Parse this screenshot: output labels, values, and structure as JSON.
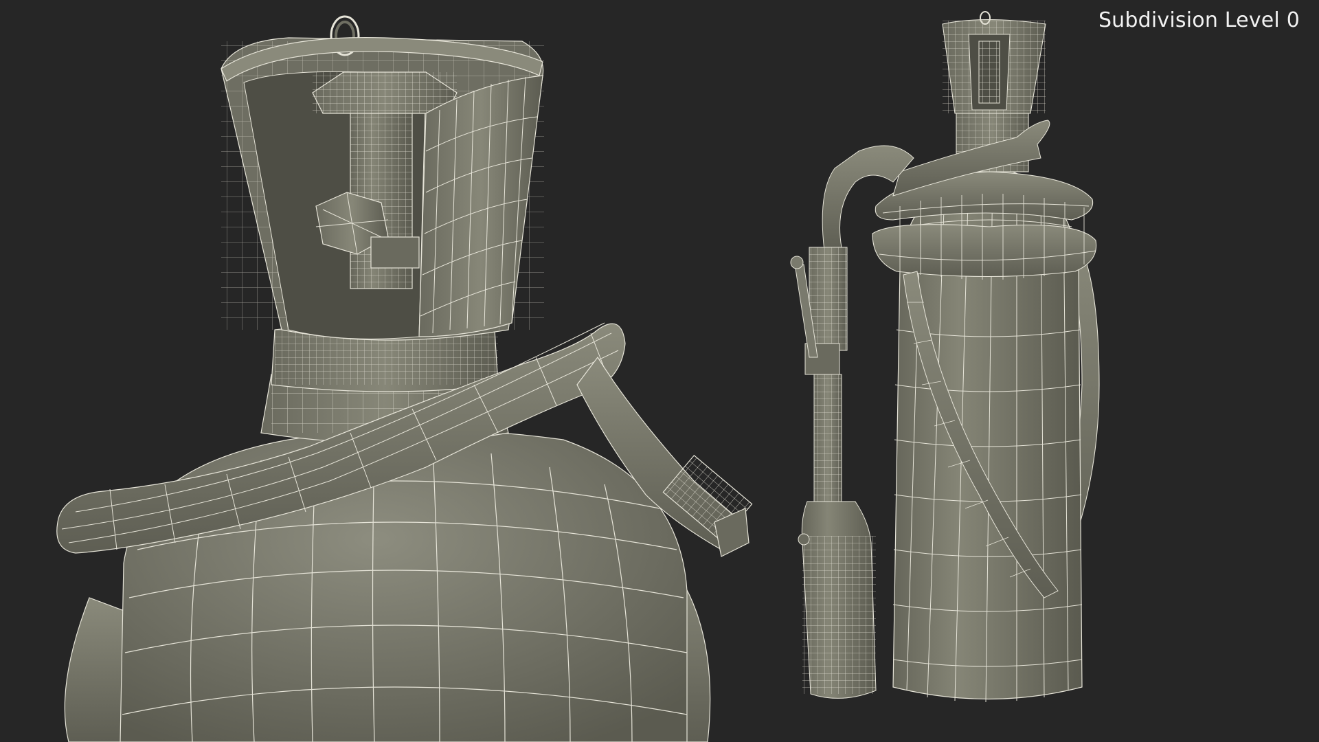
{
  "viewport": {
    "label": "Subdivision Level 0",
    "background": "#262626",
    "mesh_fill": "#7e7e70",
    "mesh_fill_dark": "#5d5d52",
    "mesh_fill_light": "#8f8f80",
    "wire_color": "#e6e4d8"
  }
}
